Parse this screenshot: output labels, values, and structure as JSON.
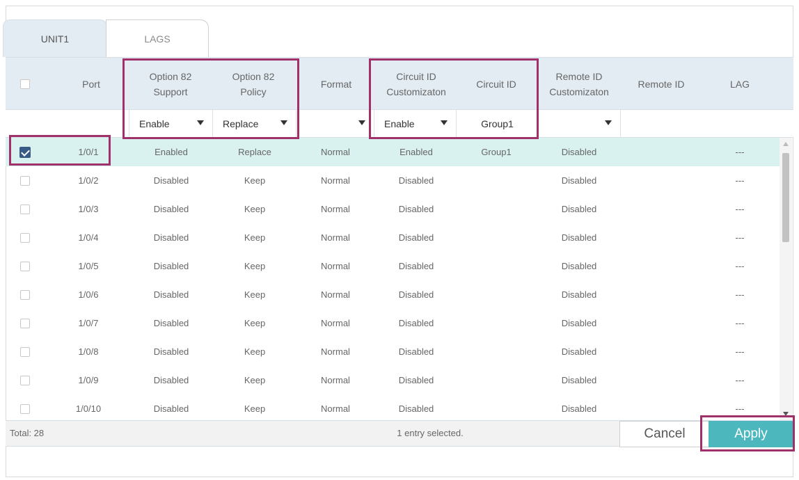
{
  "tabs": [
    {
      "label": "UNIT1"
    },
    {
      "label": "LAGS"
    }
  ],
  "columns": {
    "port": "Port",
    "opt82_support": "Option 82\nSupport",
    "opt82_policy": "Option 82\nPolicy",
    "format": "Format",
    "circuit_custom": "Circuit ID\nCustomizaton",
    "circuit_id": "Circuit ID",
    "remote_custom": "Remote ID\nCustomizaton",
    "remote_id": "Remote ID",
    "lag": "LAG"
  },
  "filters": {
    "opt82_support": "Enable",
    "opt82_policy": "Replace",
    "format": "",
    "circuit_custom": "Enable",
    "circuit_id": "Group1",
    "remote_custom": ""
  },
  "rows": [
    {
      "port": "1/0/1",
      "support": "Enabled",
      "policy": "Replace",
      "format": "Normal",
      "circuit_custom": "Enabled",
      "circuit_id": "Group1",
      "remote_custom": "Disabled",
      "remote_id": "",
      "lag": "---",
      "checked": true
    },
    {
      "port": "1/0/2",
      "support": "Disabled",
      "policy": "Keep",
      "format": "Normal",
      "circuit_custom": "Disabled",
      "circuit_id": "",
      "remote_custom": "Disabled",
      "remote_id": "",
      "lag": "---",
      "checked": false
    },
    {
      "port": "1/0/3",
      "support": "Disabled",
      "policy": "Keep",
      "format": "Normal",
      "circuit_custom": "Disabled",
      "circuit_id": "",
      "remote_custom": "Disabled",
      "remote_id": "",
      "lag": "---",
      "checked": false
    },
    {
      "port": "1/0/4",
      "support": "Disabled",
      "policy": "Keep",
      "format": "Normal",
      "circuit_custom": "Disabled",
      "circuit_id": "",
      "remote_custom": "Disabled",
      "remote_id": "",
      "lag": "---",
      "checked": false
    },
    {
      "port": "1/0/5",
      "support": "Disabled",
      "policy": "Keep",
      "format": "Normal",
      "circuit_custom": "Disabled",
      "circuit_id": "",
      "remote_custom": "Disabled",
      "remote_id": "",
      "lag": "---",
      "checked": false
    },
    {
      "port": "1/0/6",
      "support": "Disabled",
      "policy": "Keep",
      "format": "Normal",
      "circuit_custom": "Disabled",
      "circuit_id": "",
      "remote_custom": "Disabled",
      "remote_id": "",
      "lag": "---",
      "checked": false
    },
    {
      "port": "1/0/7",
      "support": "Disabled",
      "policy": "Keep",
      "format": "Normal",
      "circuit_custom": "Disabled",
      "circuit_id": "",
      "remote_custom": "Disabled",
      "remote_id": "",
      "lag": "---",
      "checked": false
    },
    {
      "port": "1/0/8",
      "support": "Disabled",
      "policy": "Keep",
      "format": "Normal",
      "circuit_custom": "Disabled",
      "circuit_id": "",
      "remote_custom": "Disabled",
      "remote_id": "",
      "lag": "---",
      "checked": false
    },
    {
      "port": "1/0/9",
      "support": "Disabled",
      "policy": "Keep",
      "format": "Normal",
      "circuit_custom": "Disabled",
      "circuit_id": "",
      "remote_custom": "Disabled",
      "remote_id": "",
      "lag": "---",
      "checked": false
    },
    {
      "port": "1/0/10",
      "support": "Disabled",
      "policy": "Keep",
      "format": "Normal",
      "circuit_custom": "Disabled",
      "circuit_id": "",
      "remote_custom": "Disabled",
      "remote_id": "",
      "lag": "---",
      "checked": false
    }
  ],
  "footer": {
    "total": "Total: 28",
    "selected": "1 entry selected.",
    "cancel_label": "Cancel",
    "apply_label": "Apply"
  },
  "colors": {
    "accent": "#4cb8bd",
    "selected_row": "#d9f1ef",
    "header_bg": "#e3ecf3",
    "highlight": "#a0306a"
  }
}
